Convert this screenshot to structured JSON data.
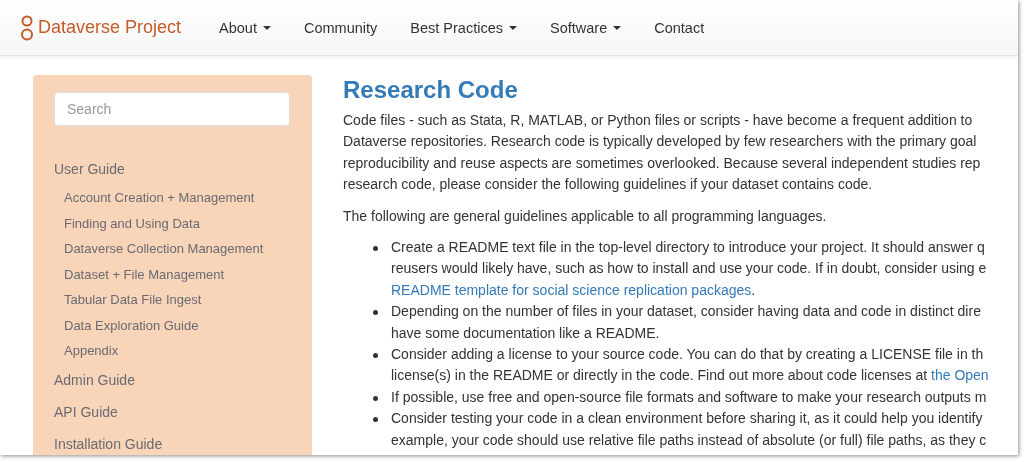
{
  "navbar": {
    "brand": "Dataverse Project",
    "items": [
      {
        "label": "About",
        "dropdown": true
      },
      {
        "label": "Community",
        "dropdown": false
      },
      {
        "label": "Best Practices",
        "dropdown": true
      },
      {
        "label": "Software",
        "dropdown": true
      },
      {
        "label": "Contact",
        "dropdown": false
      }
    ]
  },
  "sidebar": {
    "search": {
      "placeholder": "Search"
    },
    "items": [
      {
        "label": "User Guide",
        "children": [
          {
            "label": "Account Creation + Management"
          },
          {
            "label": "Finding and Using Data"
          },
          {
            "label": "Dataverse Collection Management"
          },
          {
            "label": "Dataset + File Management"
          },
          {
            "label": "Tabular Data File Ingest"
          },
          {
            "label": "Data Exploration Guide"
          },
          {
            "label": "Appendix"
          }
        ]
      },
      {
        "label": "Admin Guide"
      },
      {
        "label": "API Guide"
      },
      {
        "label": "Installation Guide"
      }
    ]
  },
  "content": {
    "title": "Research Code",
    "intro_lines": [
      "Code files - such as Stata, R, MATLAB, or Python files or scripts - have become a frequent addition to",
      "Dataverse repositories. Research code is typically developed by few researchers with the primary goal",
      "reproducibility and reuse aspects are sometimes overlooked. Because several independent studies rep",
      "research code, please consider the following guidelines if your dataset contains code."
    ],
    "lead": "The following are general guidelines applicable to all programming languages.",
    "bullets": [
      {
        "lines": [
          [
            {
              "kind": "plain",
              "text": "Create a README text file in the top-level directory to introduce your project. It should answer q"
            }
          ],
          [
            {
              "kind": "plain",
              "text": "reusers would likely have, such as how to install and use your code. If in doubt, consider using e"
            }
          ],
          [
            {
              "kind": "link",
              "text": "README template for social science replication packages"
            },
            {
              "kind": "plain",
              "text": "."
            }
          ]
        ]
      },
      {
        "lines": [
          [
            {
              "kind": "plain",
              "text": "Depending on the number of files in your dataset, consider having data and code in distinct dire"
            }
          ],
          [
            {
              "kind": "plain",
              "text": "have some documentation like a README."
            }
          ]
        ]
      },
      {
        "lines": [
          [
            {
              "kind": "plain",
              "text": "Consider adding a license to your source code. You can do that by creating a LICENSE file in th"
            }
          ],
          [
            {
              "kind": "plain",
              "text": "license(s) in the README or directly in the code. Find out more about code licenses at "
            },
            {
              "kind": "link",
              "text": "the Open"
            }
          ]
        ]
      },
      {
        "lines": [
          [
            {
              "kind": "plain",
              "text": "If possible, use free and open-source file formats and software to make your research outputs m"
            }
          ]
        ]
      },
      {
        "lines": [
          [
            {
              "kind": "plain",
              "text": "Consider testing your code in a clean environment before sharing it, as it could help you identify"
            }
          ],
          [
            {
              "kind": "plain",
              "text": "example, your code should use relative file paths instead of absolute (or full) file paths, as they c"
            }
          ]
        ]
      }
    ]
  }
}
